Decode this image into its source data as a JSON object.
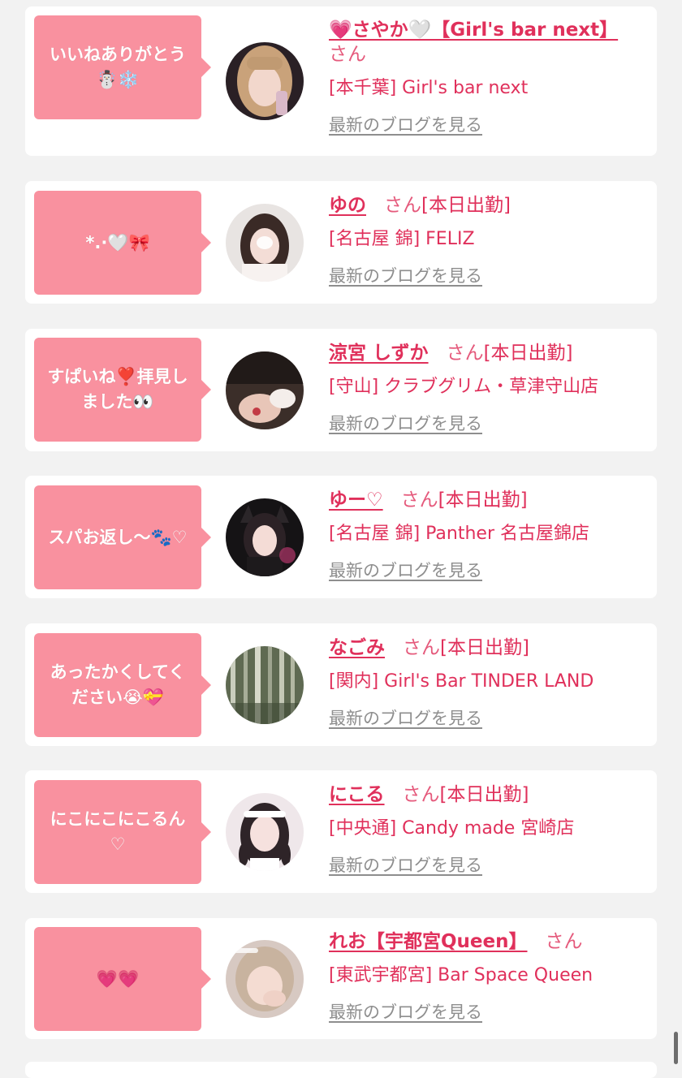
{
  "cards": [
    {
      "comment": "いいねありがとう\n☃️❄️",
      "name": "💗さやか🤍【Girl's bar next】",
      "san": "さん",
      "status": "",
      "shop": "[本千葉] Girl's bar next",
      "blog_link": "最新のブログを見る",
      "avatar_desc": "girl-blonde"
    },
    {
      "comment": "*.·🤍🎀",
      "name": "ゆの",
      "san": "さん",
      "status": "[本日出勤]",
      "shop": "[名古屋 錦] FELIZ",
      "blog_link": "最新のブログを見る",
      "avatar_desc": "girl-dark-hair"
    },
    {
      "comment": "すぱいね❣️拝見し\nました👀",
      "name": "涼宮 しずか",
      "san": "さん",
      "status": "[本日出勤]",
      "shop": "[守山] クラブグリム・草津守山店",
      "blog_link": "最新のブログを見る",
      "avatar_desc": "hand-closeup"
    },
    {
      "comment": "スパお返し〜🐾♡",
      "name": "ゆー♡",
      "san": "さん",
      "status": "[本日出勤]",
      "shop": "[名古屋 錦] Panther 名古屋錦店",
      "blog_link": "最新のブログを見る",
      "avatar_desc": "girl-cat-ears"
    },
    {
      "comment": "あったかくしてく\nださい😭💝",
      "name": "なごみ",
      "san": "さん",
      "status": "[本日出勤]",
      "shop": "[関内] Girl's Bar TINDER LAND",
      "blog_link": "最新のブログを見る",
      "avatar_desc": "bamboo-forest"
    },
    {
      "comment": "にこにこにこるん\n♡",
      "name": "にこる",
      "san": "さん",
      "status": "[本日出勤]",
      "shop": "[中央通] Candy made 宮崎店",
      "blog_link": "最新のブログを見る",
      "avatar_desc": "girl-maid"
    },
    {
      "comment": "💗💗",
      "name": "れお【宇都宮Queen】",
      "san": "さん",
      "status": "",
      "shop": "[東武宇都宮] Bar Space Queen",
      "blog_link": "最新のブログを見る",
      "avatar_desc": "girl-light-hair"
    }
  ],
  "colors": {
    "page_bg": "#f2f2f2",
    "card_bg": "#ffffff",
    "bubble_bg": "#f9919f",
    "name_color": "#e0305b",
    "blog_link_color": "#8e8e8e"
  }
}
